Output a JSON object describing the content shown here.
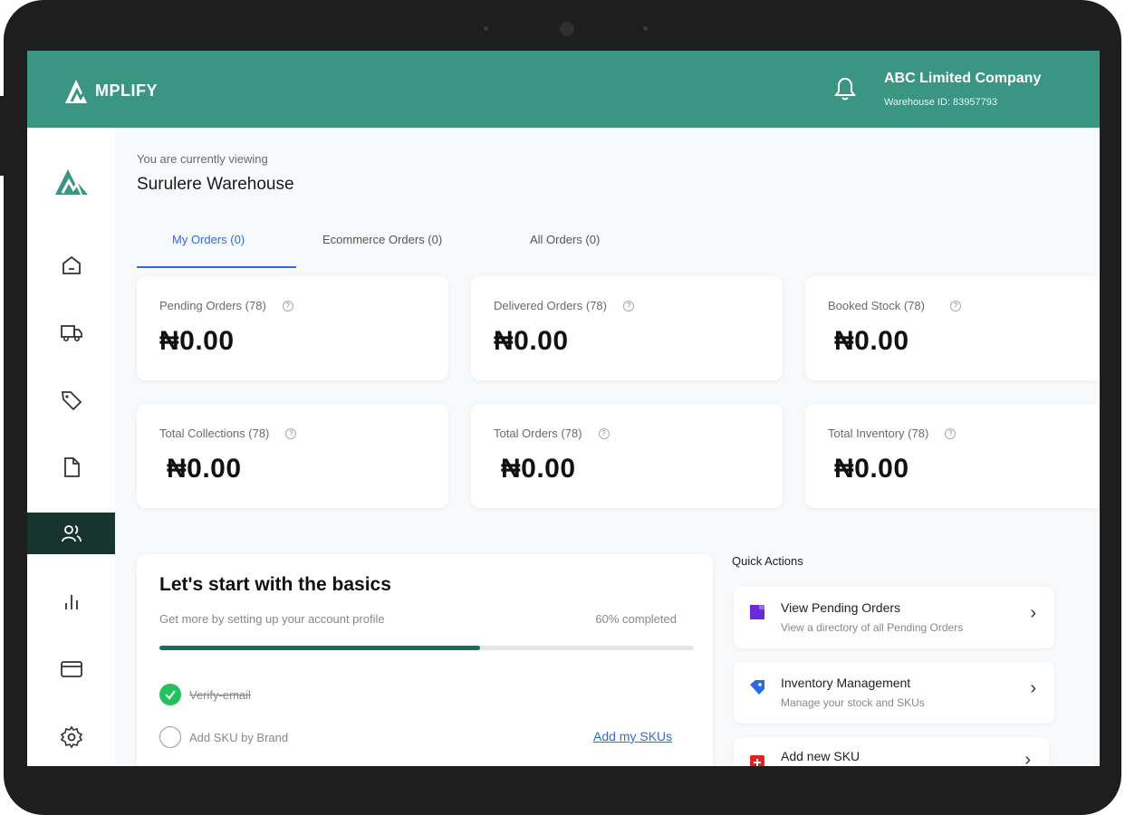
{
  "header": {
    "brand": "MPLIFY",
    "company_name": "ABC Limited Company",
    "warehouse_id": "Warehouse ID: 83957793"
  },
  "page": {
    "viewing_label": "You are currently viewing",
    "warehouse_name": "Surulere Warehouse"
  },
  "tabs": [
    {
      "label": "My Orders (0)",
      "active": true
    },
    {
      "label": "Ecommerce Orders (0)",
      "active": false
    },
    {
      "label": "All Orders (0)",
      "active": false
    }
  ],
  "stats": [
    {
      "label": "Pending Orders (78)",
      "value": "₦0.00"
    },
    {
      "label": "Delivered Orders (78)",
      "value": "₦0.00"
    },
    {
      "label": "Booked Stock (78)",
      "value": "₦0.00"
    },
    {
      "label": "Total Collections (78)",
      "value": "₦0.00"
    },
    {
      "label": "Total Orders (78)",
      "value": "₦0.00"
    },
    {
      "label": "Total Inventory (78)",
      "value": "₦0.00"
    }
  ],
  "basics": {
    "title": "Let's start with the basics",
    "subtitle": "Get more by setting up your account profile",
    "progress_label": "60% completed",
    "progress_fraction": 0.6,
    "tasks": [
      {
        "label": "Verify-email",
        "done": true
      },
      {
        "label": "Add SKU by Brand",
        "done": false
      }
    ],
    "add_skus_link": "Add my SKUs"
  },
  "quick_actions": {
    "title": "Quick Actions",
    "items": [
      {
        "title": "View Pending Orders",
        "subtitle": "View a directory of all Pending Orders",
        "icon": "document-purple-icon"
      },
      {
        "title": "Inventory Management",
        "subtitle": "Manage your stock and SKUs",
        "icon": "tag-blue-icon"
      },
      {
        "title": "Add new SKU",
        "subtitle": "",
        "icon": "plus-red-icon"
      }
    ]
  },
  "sidebar": {
    "items": [
      "home-icon",
      "truck-icon",
      "tag-icon",
      "file-icon",
      "users-icon",
      "bar-chart-icon",
      "card-icon",
      "gear-icon"
    ],
    "active": "users-icon"
  },
  "colors": {
    "topbar": "#3a9683",
    "sidebar_active": "#17342d",
    "tab_active": "#2d6cdf",
    "progress": "#1d6b5e",
    "check": "#22c15e"
  }
}
